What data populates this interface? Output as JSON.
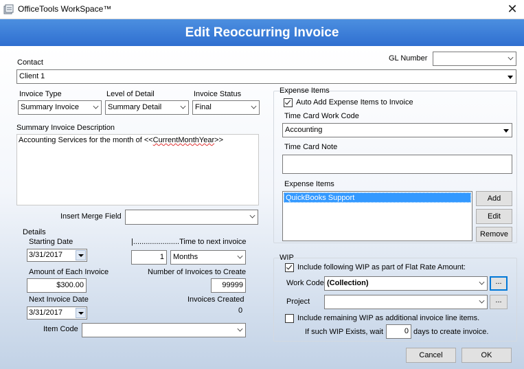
{
  "window": {
    "title": "OfficeTools WorkSpace™",
    "close_glyph": "✕"
  },
  "header": {
    "title": "Edit Reoccurring Invoice"
  },
  "contact": {
    "label": "Contact",
    "value": "Client 1"
  },
  "gl_number": {
    "label": "GL Number",
    "value": ""
  },
  "invoice_type": {
    "label": "Invoice Type",
    "value": "Summary Invoice"
  },
  "level_of_detail": {
    "label": "Level of Detail",
    "value": "Summary Detail"
  },
  "invoice_status": {
    "label": "Invoice Status",
    "value": "Final"
  },
  "summary_description": {
    "label": "Summary Invoice Description",
    "text_prefix": "Accounting Services for the month of <<",
    "text_token": "CurrentMonthYear",
    "text_suffix": ">>"
  },
  "merge_field": {
    "label": "Insert Merge Field",
    "value": ""
  },
  "details": {
    "label": "Details",
    "starting_date_label": "Starting Date",
    "starting_date": "3/31/2017",
    "time_to_next_label": "|......................Time to next invoice",
    "interval_value": "1",
    "interval_unit": "Months",
    "amount_label": "Amount of Each Invoice",
    "amount": "$300.00",
    "num_invoices_label": "Number of Invoices to Create",
    "num_invoices": "99999",
    "next_date_label": "Next Invoice Date",
    "next_date": "3/31/2017",
    "created_label": "Invoices Created",
    "created": "0",
    "item_code_label": "Item Code",
    "item_code": ""
  },
  "expense": {
    "group_label": "Expense Items",
    "auto_add_label": "Auto Add Expense Items to Invoice",
    "auto_add_checked": true,
    "work_code_label": "Time Card Work Code",
    "work_code": "Accounting",
    "note_label": "Time Card Note",
    "note": "",
    "items_label": "Expense Items",
    "items": [
      "QuickBooks Support"
    ],
    "add_label": "Add",
    "edit_label": "Edit",
    "remove_label": "Remove"
  },
  "wip": {
    "group_label": "WIP",
    "include_label": "Include following WIP as part of Flat Rate Amount:",
    "include_checked": true,
    "work_code_label": "Work Code",
    "work_code": "(Collection)",
    "project_label": "Project",
    "project": "",
    "ellipsis": "...",
    "remaining_label": "Include remaining WIP as additional invoice line items.",
    "remaining_checked": false,
    "wait_prefix": "If such WIP Exists, wait",
    "wait_days": "0",
    "wait_suffix": "days to create invoice."
  },
  "footer": {
    "cancel_label": "Cancel",
    "ok_label": "OK"
  },
  "colors": {
    "header_blue": "#3a7fd8",
    "selection": "#3399ff"
  }
}
